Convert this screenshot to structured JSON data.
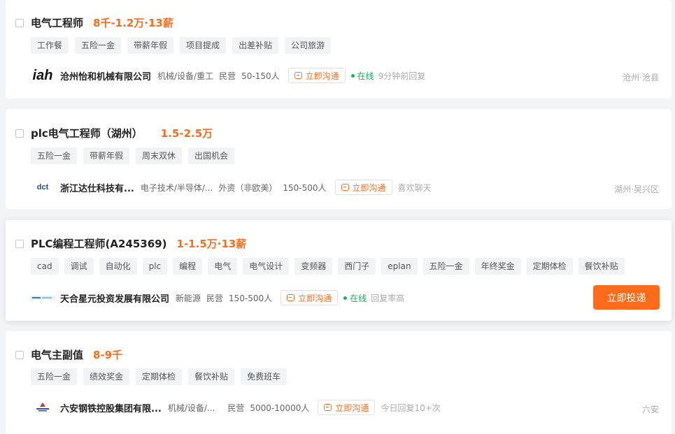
{
  "jobs": [
    {
      "title": "电气工程师",
      "salary": "8千-1.2万·13薪",
      "tags": [
        "工作餐",
        "五险一金",
        "带薪年假",
        "项目提成",
        "出差补贴",
        "公司旅游"
      ],
      "company": {
        "logo_text": "iah",
        "name": "沧州怡和机械有限公司",
        "industry": "机械/设备/重工",
        "type": "民营",
        "size": "50-150人"
      },
      "chat_label": "立即沟通",
      "online_label": "在线",
      "reply_text": "9分钟前回复",
      "location": "沧州·沧县"
    },
    {
      "title": "plc电气工程师（湖州）",
      "salary": "1.5-2.5万",
      "tags": [
        "五险一金",
        "带薪年假",
        "周末双休",
        "出国机会"
      ],
      "company": {
        "logo_text": "dct",
        "name": "浙江达仕科技有...",
        "industry": "电子技术/半导体/...",
        "type": "外资（非欧美）",
        "size": "150-500人"
      },
      "chat_label": "立即沟通",
      "reply_text": "喜欢聊天",
      "location": "湖州·吴兴区"
    },
    {
      "title": "PLC编程工程师(A245369)",
      "salary": "1-1.5万·13薪",
      "tags": [
        "cad",
        "调试",
        "自动化",
        "plc",
        "编程",
        "电气",
        "电气设计",
        "变频器",
        "西门子",
        "eplan",
        "五险一金",
        "年终奖金",
        "定期体检",
        "餐饮补贴"
      ],
      "company": {
        "name": "天合星元投资发展有限公司",
        "industry": "新能源",
        "type": "民营",
        "size": "150-500人"
      },
      "chat_label": "立即沟通",
      "online_label": "在线",
      "reply_text": "回复率高",
      "apply_label": "立即投递"
    },
    {
      "title": "电气主副值",
      "salary": "8-9千",
      "tags": [
        "五险一金",
        "绩效奖金",
        "定期体检",
        "餐饮补贴",
        "免费班车"
      ],
      "company": {
        "name": "六安钢铁控股集团有限...",
        "industry": "机械/设备/...",
        "type": "民营",
        "size": "5000-10000人"
      },
      "chat_label": "立即沟通",
      "reply_text": "今日回复10+次",
      "location": "六安"
    }
  ],
  "colors": {
    "accent": "#fe6c1b",
    "online": "#17b15b",
    "tag_bg": "#f2f3f5",
    "page_bg": "#f3f4f6"
  }
}
